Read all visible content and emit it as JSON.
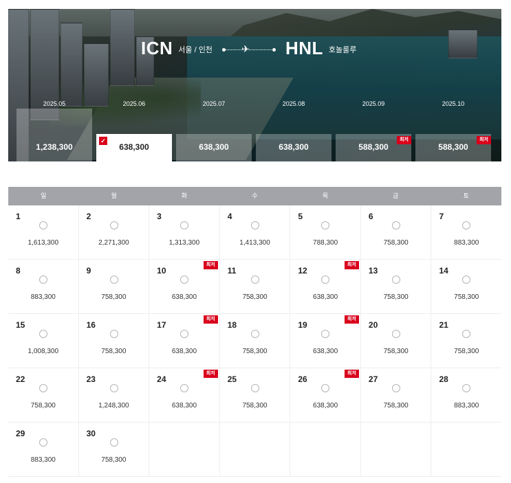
{
  "route": {
    "origin_code": "ICN",
    "origin_city": "서울 / 인천",
    "destination_code": "HNL",
    "destination_city": "호놀룰루",
    "plane_icon": "airplane-icon"
  },
  "months": [
    {
      "label": "2025.05",
      "price": "1,238,300",
      "state": "faded",
      "lowest": false
    },
    {
      "label": "2025.06",
      "price": "638,300",
      "state": "selected",
      "lowest": false
    },
    {
      "label": "2025.07",
      "price": "638,300",
      "state": "normal",
      "lowest": false
    },
    {
      "label": "2025.08",
      "price": "638,300",
      "state": "normal",
      "lowest": false
    },
    {
      "label": "2025.09",
      "price": "588,300",
      "state": "normal",
      "lowest": true
    },
    {
      "label": "2025.10",
      "price": "588,300",
      "state": "normal",
      "lowest": true
    }
  ],
  "lowest_label": "최저",
  "colors": {
    "accent": "#d9001b",
    "header_bg": "#a2a4a9"
  },
  "weekdays": [
    "일",
    "월",
    "화",
    "수",
    "목",
    "금",
    "토"
  ],
  "calendar": [
    [
      {
        "day": "1",
        "price": "1,613,300",
        "lowest": false
      },
      {
        "day": "2",
        "price": "2,271,300",
        "lowest": false
      },
      {
        "day": "3",
        "price": "1,313,300",
        "lowest": false
      },
      {
        "day": "4",
        "price": "1,413,300",
        "lowest": false
      },
      {
        "day": "5",
        "price": "788,300",
        "lowest": false
      },
      {
        "day": "6",
        "price": "758,300",
        "lowest": false
      },
      {
        "day": "7",
        "price": "883,300",
        "lowest": false
      }
    ],
    [
      {
        "day": "8",
        "price": "883,300",
        "lowest": false
      },
      {
        "day": "9",
        "price": "758,300",
        "lowest": false
      },
      {
        "day": "10",
        "price": "638,300",
        "lowest": true
      },
      {
        "day": "11",
        "price": "758,300",
        "lowest": false
      },
      {
        "day": "12",
        "price": "638,300",
        "lowest": true
      },
      {
        "day": "13",
        "price": "758,300",
        "lowest": false
      },
      {
        "day": "14",
        "price": "758,300",
        "lowest": false
      }
    ],
    [
      {
        "day": "15",
        "price": "1,008,300",
        "lowest": false
      },
      {
        "day": "16",
        "price": "758,300",
        "lowest": false
      },
      {
        "day": "17",
        "price": "638,300",
        "lowest": true
      },
      {
        "day": "18",
        "price": "758,300",
        "lowest": false
      },
      {
        "day": "19",
        "price": "638,300",
        "lowest": true
      },
      {
        "day": "20",
        "price": "758,300",
        "lowest": false
      },
      {
        "day": "21",
        "price": "758,300",
        "lowest": false
      }
    ],
    [
      {
        "day": "22",
        "price": "758,300",
        "lowest": false
      },
      {
        "day": "23",
        "price": "1,248,300",
        "lowest": false
      },
      {
        "day": "24",
        "price": "638,300",
        "lowest": true
      },
      {
        "day": "25",
        "price": "758,300",
        "lowest": false
      },
      {
        "day": "26",
        "price": "638,300",
        "lowest": true
      },
      {
        "day": "27",
        "price": "758,300",
        "lowest": false
      },
      {
        "day": "28",
        "price": "883,300",
        "lowest": false
      }
    ],
    [
      {
        "day": "29",
        "price": "883,300",
        "lowest": false
      },
      {
        "day": "30",
        "price": "758,300",
        "lowest": false
      },
      null,
      null,
      null,
      null,
      null
    ]
  ]
}
